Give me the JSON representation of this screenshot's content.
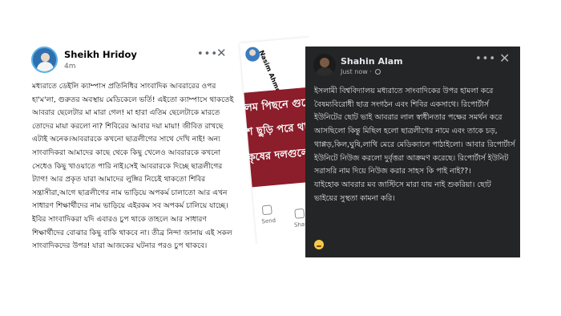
{
  "post_left": {
    "author": "Sheikh Hridoy",
    "time": "4m",
    "more_icon": "more-horizontal-icon",
    "close_icon": "close-icon",
    "text": "মধ্যরাতে ডেইলি ক্যাম্পাস প্রতিনিধির সাংবাদিক আবরারের ওপর হা'ম'লা, গুরুতর অবস্থায় মেডিকেলে ভর্তি! এইতো ক্যাম্পাসে থাকতেই আবরার ছেলেটার মা মারা গেল! মা হারা এতিম ছেলেটাকে মারতে তোদের মায়া করলো না? শিবিরের আবার দয়া মায়া! জীবিত রাখছে এটাই অনেক।আবরারকে কখনো ছাত্রলীগের সাথে দেখি নাই! অন্য সাংবাদিকরা আমাদের কাছে থেকে কিছু খেলেও আবরারকে কখনো সেধেও কিছু খাওয়াতে পারি নাই।সেই আবরারকে দিচ্ছে ছাত্রলীগের ট্যাগ! আর প্রকৃত যারা আমাদের লুঙ্গির নিচেই থাকতো শিবির সন্ত্রাসীরা,আগে ছাত্রলীগের নাম ভাড়িয়ে অপকর্ম চালাতো আর এখন সাধারণ শিক্ষার্থীদের নাম ভাড়িয়ে এইরকম সব অপকর্ম চালিয়ে যাচ্ছে। ইবির সাংবাদিকরা যদি এবারও চুপ থাকে তাহলে আর সাধারণ শিক্ষার্থীদের বোঝার কিছু বাকি থাকবে না। তীব্র নিন্দা জানায় এই সকল সাংবাদিকদের উপর! যারা আজকের ঘটনার পরও চুপ থাকবে।"
  },
  "post_middle": {
    "author": "Nasim Ahmed Joy",
    "image_lines": [
      "কলম পিছনে গুজে",
      "শে ছুড়ি পরে থাক",
      "কৃষের দলগুলো।"
    ],
    "actions": [
      "Send",
      "Share"
    ],
    "image_color": "#8c1d2a"
  },
  "post_right": {
    "author": "Shahin Alam",
    "time": "Just now",
    "privacy_icon": "globe-icon",
    "more_icon": "more-horizontal-icon",
    "close_icon": "close-icon",
    "text": "ইসলামী বিশ্ববিদ্যালয় মধ্যরাতে সাংবাদিকের উপর হামলা করে বৈষম্যবিরোধী ছাত্র সংগঠন এবং শিবির একসাথে। রিপোর্টার্স ইউনিটের ছোট ভাই আবরার লাল স্বাধীনতার পক্ষের সমর্থন করে আসছিলো কিন্তু মিছিল হলো ছাত্রলীগের নামে এবং তাকে চড়, থাপ্পড়,কিল,ঘুষি,লাথি মেরে মেডিক্যালে পাঠাইলো। আবার রিপোর্টার্স ইউনিটে নিউজ করলো দুর্বৃত্তরা আক্রমণ করেছে। রিপোর্টার্স ইউনিট সরাসরি নাম দিয়ে নিউজ করার সাহস কি পাই নাই??।\nযাইহোক আবরার মব জাস্টিসে মারা যায় নাই শুকরিয়া। ছোট ভাইয়ের সুস্থতা কামনা করি।",
    "reaction_icon": "sad-face-icon",
    "background_color": "#242526"
  }
}
